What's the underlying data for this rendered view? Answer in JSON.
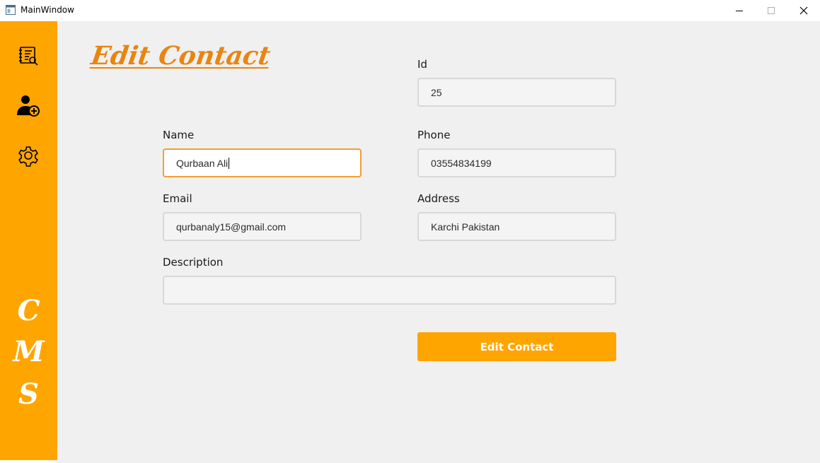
{
  "window": {
    "title": "MainWindow",
    "controls": [
      "minimize",
      "maximize",
      "close"
    ]
  },
  "sidebar": {
    "icons": [
      "contacts-book-icon",
      "add-user-icon",
      "gear-icon"
    ],
    "brand_letters": [
      "C",
      "M",
      "S"
    ]
  },
  "form": {
    "heading": "Edit Contact",
    "id": {
      "label": "Id",
      "value": "25"
    },
    "name": {
      "label": "Name",
      "value": "Qurbaan Ali"
    },
    "phone": {
      "label": "Phone",
      "value": "03554834199"
    },
    "email": {
      "label": "Email",
      "value": "qurbanaly15@gmail.com"
    },
    "address": {
      "label": "Address",
      "value": "Karchi Pakistan"
    },
    "description": {
      "label": "Description",
      "value": ""
    },
    "submit_label": "Edit Contact"
  },
  "colors": {
    "accent": "#ffa500",
    "heading": "#e8850f",
    "focus_border": "#f0a030",
    "background": "#f0f0f0"
  }
}
